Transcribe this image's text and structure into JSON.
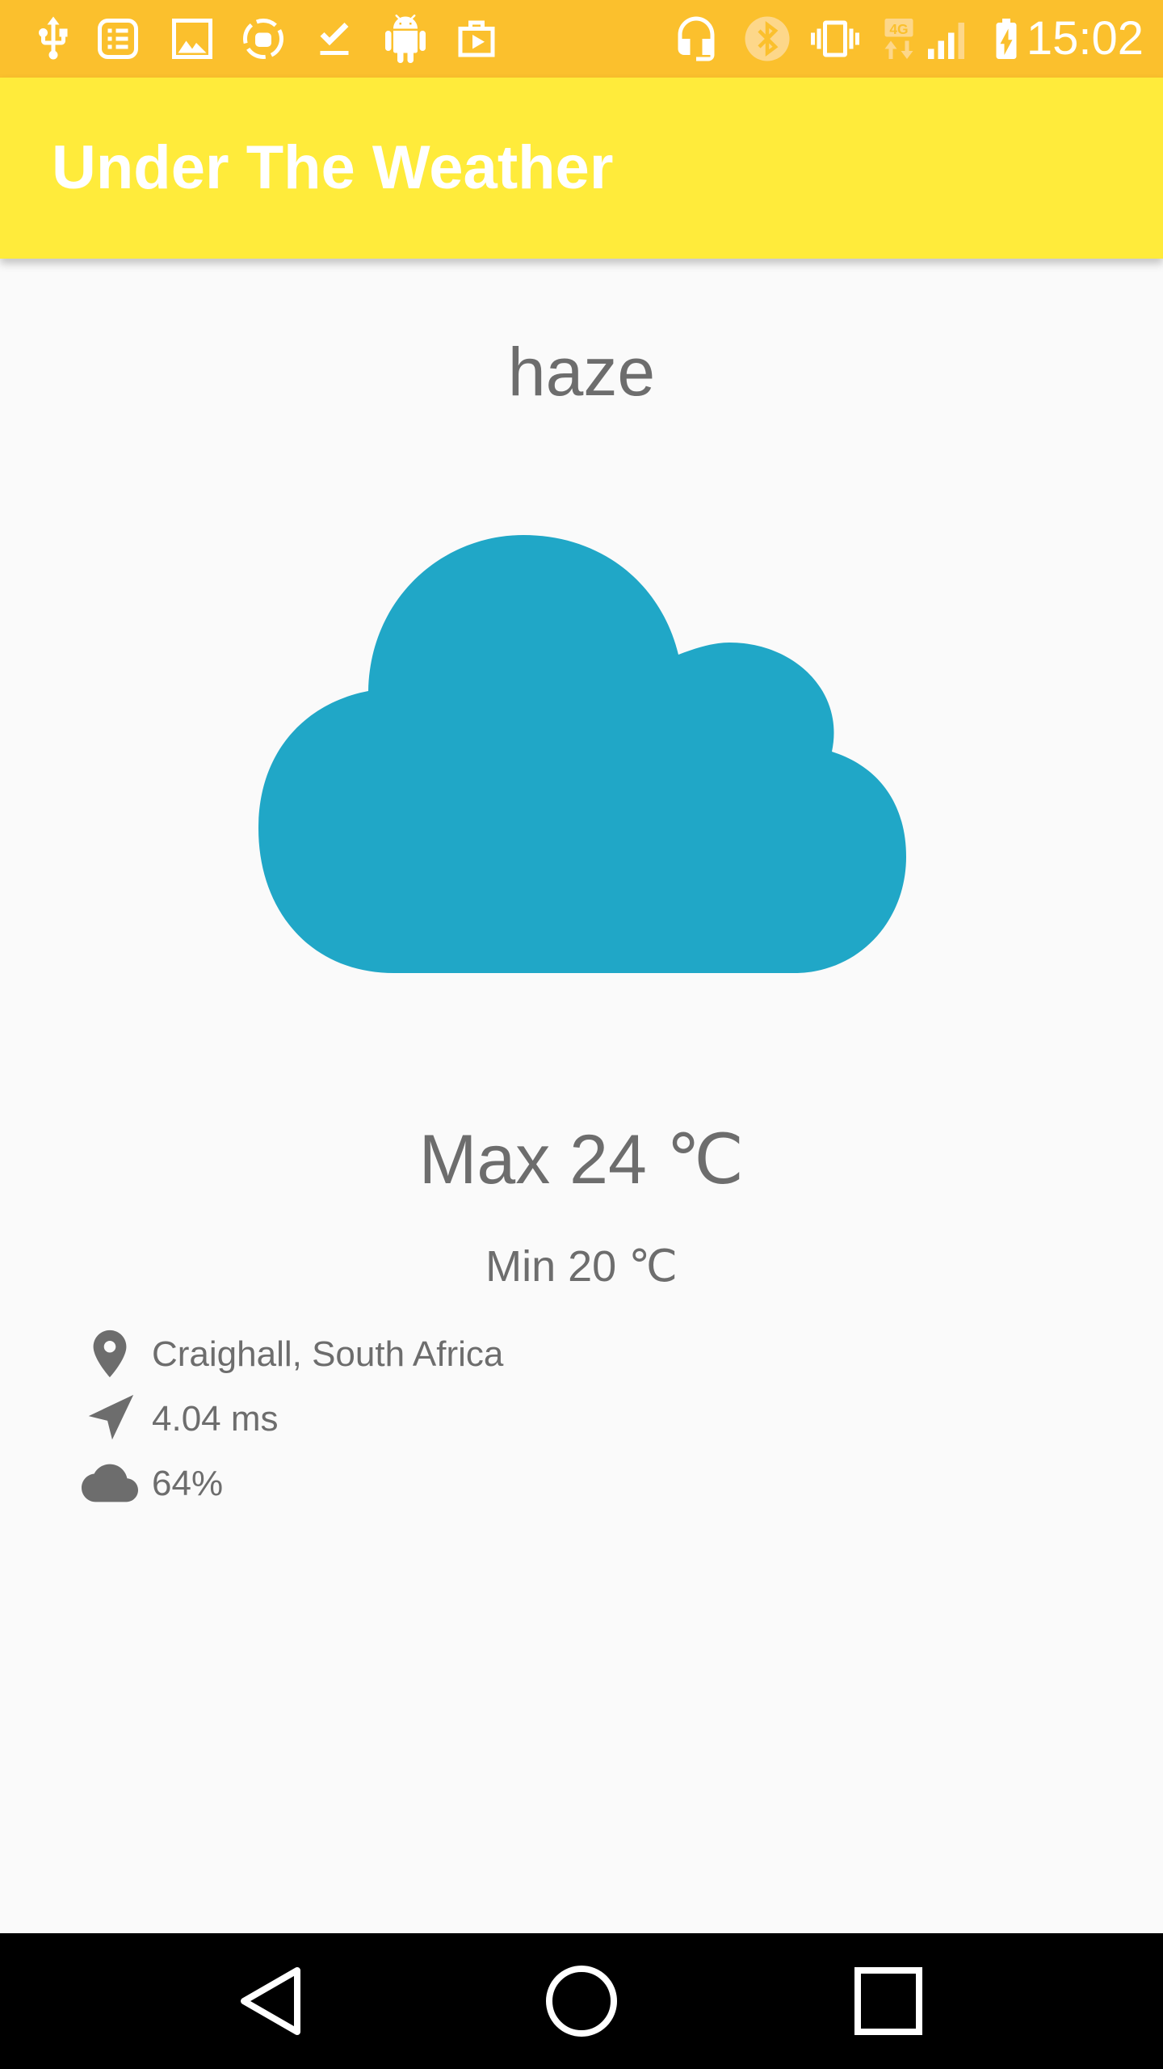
{
  "status_bar": {
    "time": "15:02",
    "network_type": "4G",
    "background_color": "#fbc02d",
    "left_icons": [
      "usb-icon",
      "notes-icon",
      "image-icon",
      "sync-icon",
      "download-done-icon",
      "android-icon",
      "play-store-icon"
    ],
    "right_icons": [
      "headset-icon",
      "bluetooth-icon",
      "vibrate-icon",
      "network-4g-icon",
      "signal-icon",
      "battery-charging-icon"
    ]
  },
  "app_bar": {
    "title": "Under The Weather",
    "background_color": "#ffeb3b"
  },
  "weather": {
    "condition": "haze",
    "icon": "cloud-icon",
    "icon_color": "#20a7c7",
    "max_temp": "Max 24 ℃",
    "min_temp": "Min 20 ℃"
  },
  "details": {
    "location": "Craighall, South Africa",
    "wind_speed": "4.04 ms",
    "cloudiness": "64%"
  },
  "nav_bar": {
    "buttons": [
      "back-icon",
      "home-icon",
      "recents-icon"
    ]
  }
}
